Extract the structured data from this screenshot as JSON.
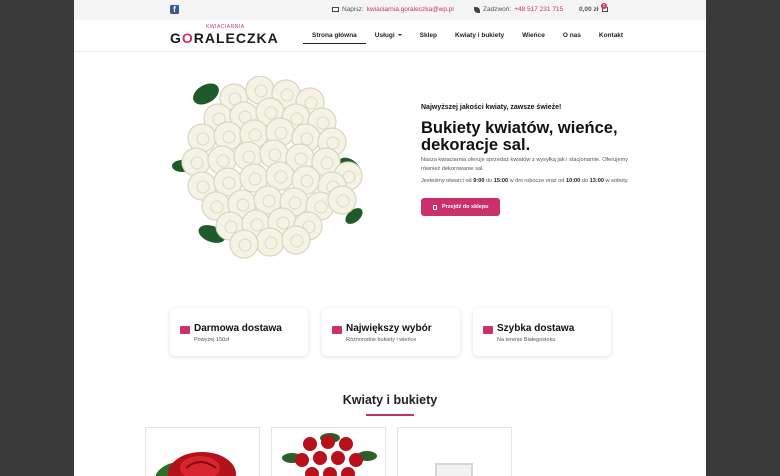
{
  "topbar": {
    "mail_label": "Napisz:",
    "mail_value": "kwiaciarnia.goraleczka@wp.pl",
    "phone_label": "Zadzwoń:",
    "phone_value": "+48 517 231 715",
    "cart_total": "0,00 zł",
    "cart_count": "0"
  },
  "brand": {
    "small": "KWIACIARNIA",
    "name_pre": "G",
    "name_o": "O",
    "name_post": "RALECZKA"
  },
  "nav": {
    "items": [
      {
        "label": "Strona główna"
      },
      {
        "label": "Usługi"
      },
      {
        "label": "Sklep"
      },
      {
        "label": "Kwiaty i bukiety"
      },
      {
        "label": "Wieńce"
      },
      {
        "label": "O nas"
      },
      {
        "label": "Kontakt"
      }
    ]
  },
  "hero": {
    "tagline": "Najwyższej jakości kwiaty, zawsze świeże!",
    "headline": "Bukiety kwiatów, wieńce, dekoracje sal.",
    "desc": "Nasza kwiaciarnia oferuje sprzedaż kwiatów z wysyłką jak i stacjonarnie. Oferujemy również dekorowanie sal.",
    "hours_pre": "Jesteśmy otwarci od",
    "hours_from": "9:00",
    "hours_mid1": "do",
    "hours_to": "15:00",
    "hours_mid2": "w dni robocze oraz od",
    "hours_sat_from": "10:00",
    "hours_mid3": "do",
    "hours_sat_to": "13:00",
    "hours_post": "w soboty.",
    "button": "Przejdź do sklepu"
  },
  "features": [
    {
      "title": "Darmowa dostawa",
      "sub": "Powyżej 150zł"
    },
    {
      "title": "Największy wybór",
      "sub": "Różnorodne bukiety i wieńce"
    },
    {
      "title": "Szybka dostawa",
      "sub": "Na terenie Białegostoku"
    }
  ],
  "section": {
    "title": "Kwiaty i bukiety"
  },
  "colors": {
    "accent": "#c9306c",
    "background": "#3a3a3a"
  }
}
